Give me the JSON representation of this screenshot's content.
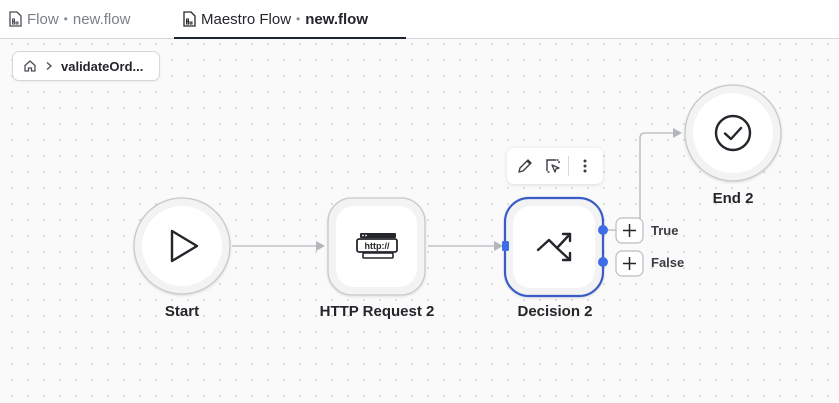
{
  "tabs": [
    {
      "prefix": "Flow",
      "sep": "•",
      "file": "new.flow",
      "active": false
    },
    {
      "prefix": "Maestro Flow",
      "sep": "•",
      "file": "new.flow",
      "active": true
    }
  ],
  "breadcrumb": {
    "home_icon": "home-icon",
    "separator_icon": "chevron-right-icon",
    "item": "validateOrd..."
  },
  "nodes": {
    "start": {
      "label": "Start",
      "icon": "play-icon"
    },
    "http": {
      "label": "HTTP Request 2",
      "icon": "http-icon",
      "icon_text": "http://"
    },
    "decision": {
      "label": "Decision 2",
      "icon": "decision-arrows-icon",
      "selected": true
    },
    "end": {
      "label": "End 2",
      "icon": "check-circle-icon"
    }
  },
  "branches": {
    "true_label": "True",
    "false_label": "False"
  },
  "node_toolbar": {
    "items": [
      "edit-icon",
      "select-icon",
      "more-vertical-icon"
    ]
  },
  "colors": {
    "selection": "#3a5bc7",
    "port": "#3d6ee8",
    "edge": "#b3b6bc",
    "text": "#24262b"
  }
}
